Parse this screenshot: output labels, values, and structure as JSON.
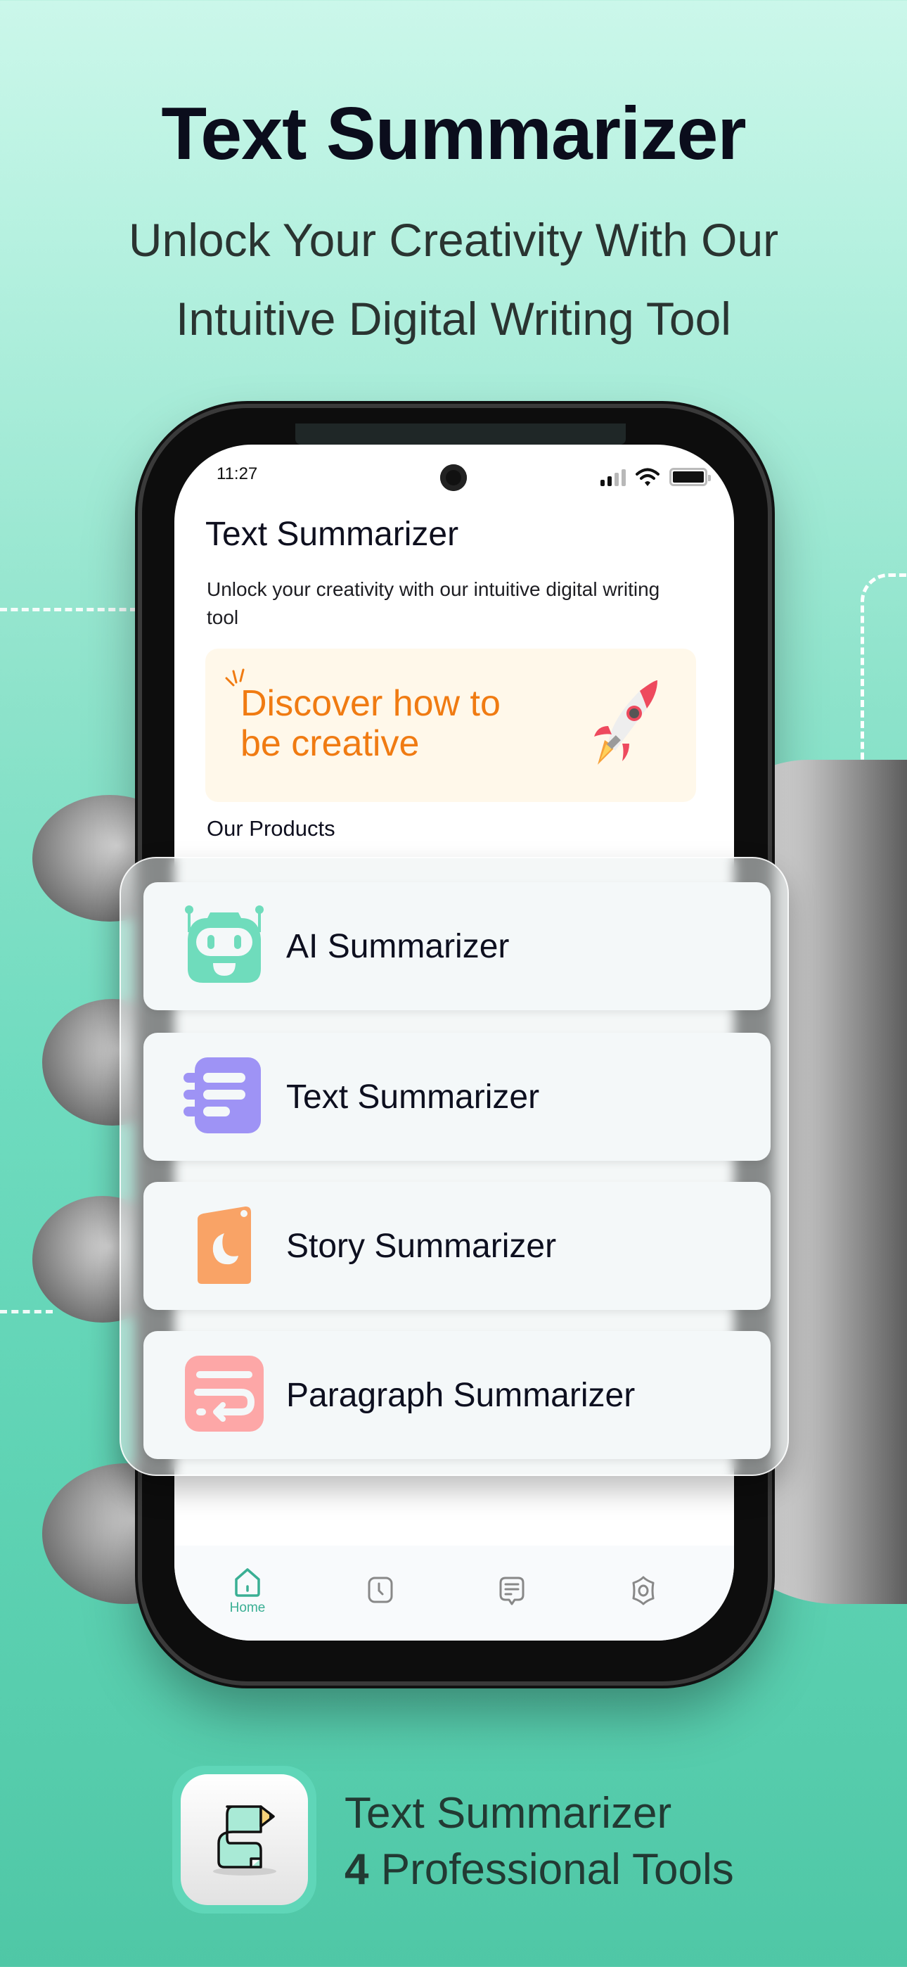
{
  "hero": {
    "title": "Text Summarizer",
    "subtitle_line1": "Unlock Your Creativity With Our",
    "subtitle_line2": "Intuitive Digital Writing Tool"
  },
  "status_bar": {
    "time": "11:27",
    "icons": [
      "signal-icon",
      "wifi-icon",
      "battery-icon"
    ]
  },
  "app": {
    "title": "Text Summarizer",
    "description": "Unlock your creativity with our intuitive digital writing tool",
    "banner": {
      "line1": "Discover how to",
      "line2": "be creative",
      "icon": "rocket-icon",
      "text_color": "#f07b12",
      "background": "#fff8ea"
    },
    "section_label": "Our Products",
    "products": [
      {
        "label": "AI Summarizer",
        "icon": "robot-icon",
        "color": "#6fdcbc"
      },
      {
        "label": "Text Summarizer",
        "icon": "text-lines-icon",
        "color": "#9e93f5"
      },
      {
        "label": "Story Summarizer",
        "icon": "moon-book-icon",
        "color": "#f9a366"
      },
      {
        "label": "Paragraph Summarizer",
        "icon": "paragraph-wrap-icon",
        "color": "#fda7a7"
      }
    ],
    "bottom_nav": [
      {
        "label": "Home",
        "icon": "home-icon",
        "active": true
      },
      {
        "label": "",
        "icon": "history-clock-icon",
        "active": false
      },
      {
        "label": "",
        "icon": "chat-icon",
        "active": false
      },
      {
        "label": "",
        "icon": "settings-icon",
        "active": false
      }
    ],
    "accent_color": "#3aaf94"
  },
  "promo": {
    "line1": "Text Summarizer",
    "line2_number": "4",
    "line2_text": " Professional Tools"
  }
}
